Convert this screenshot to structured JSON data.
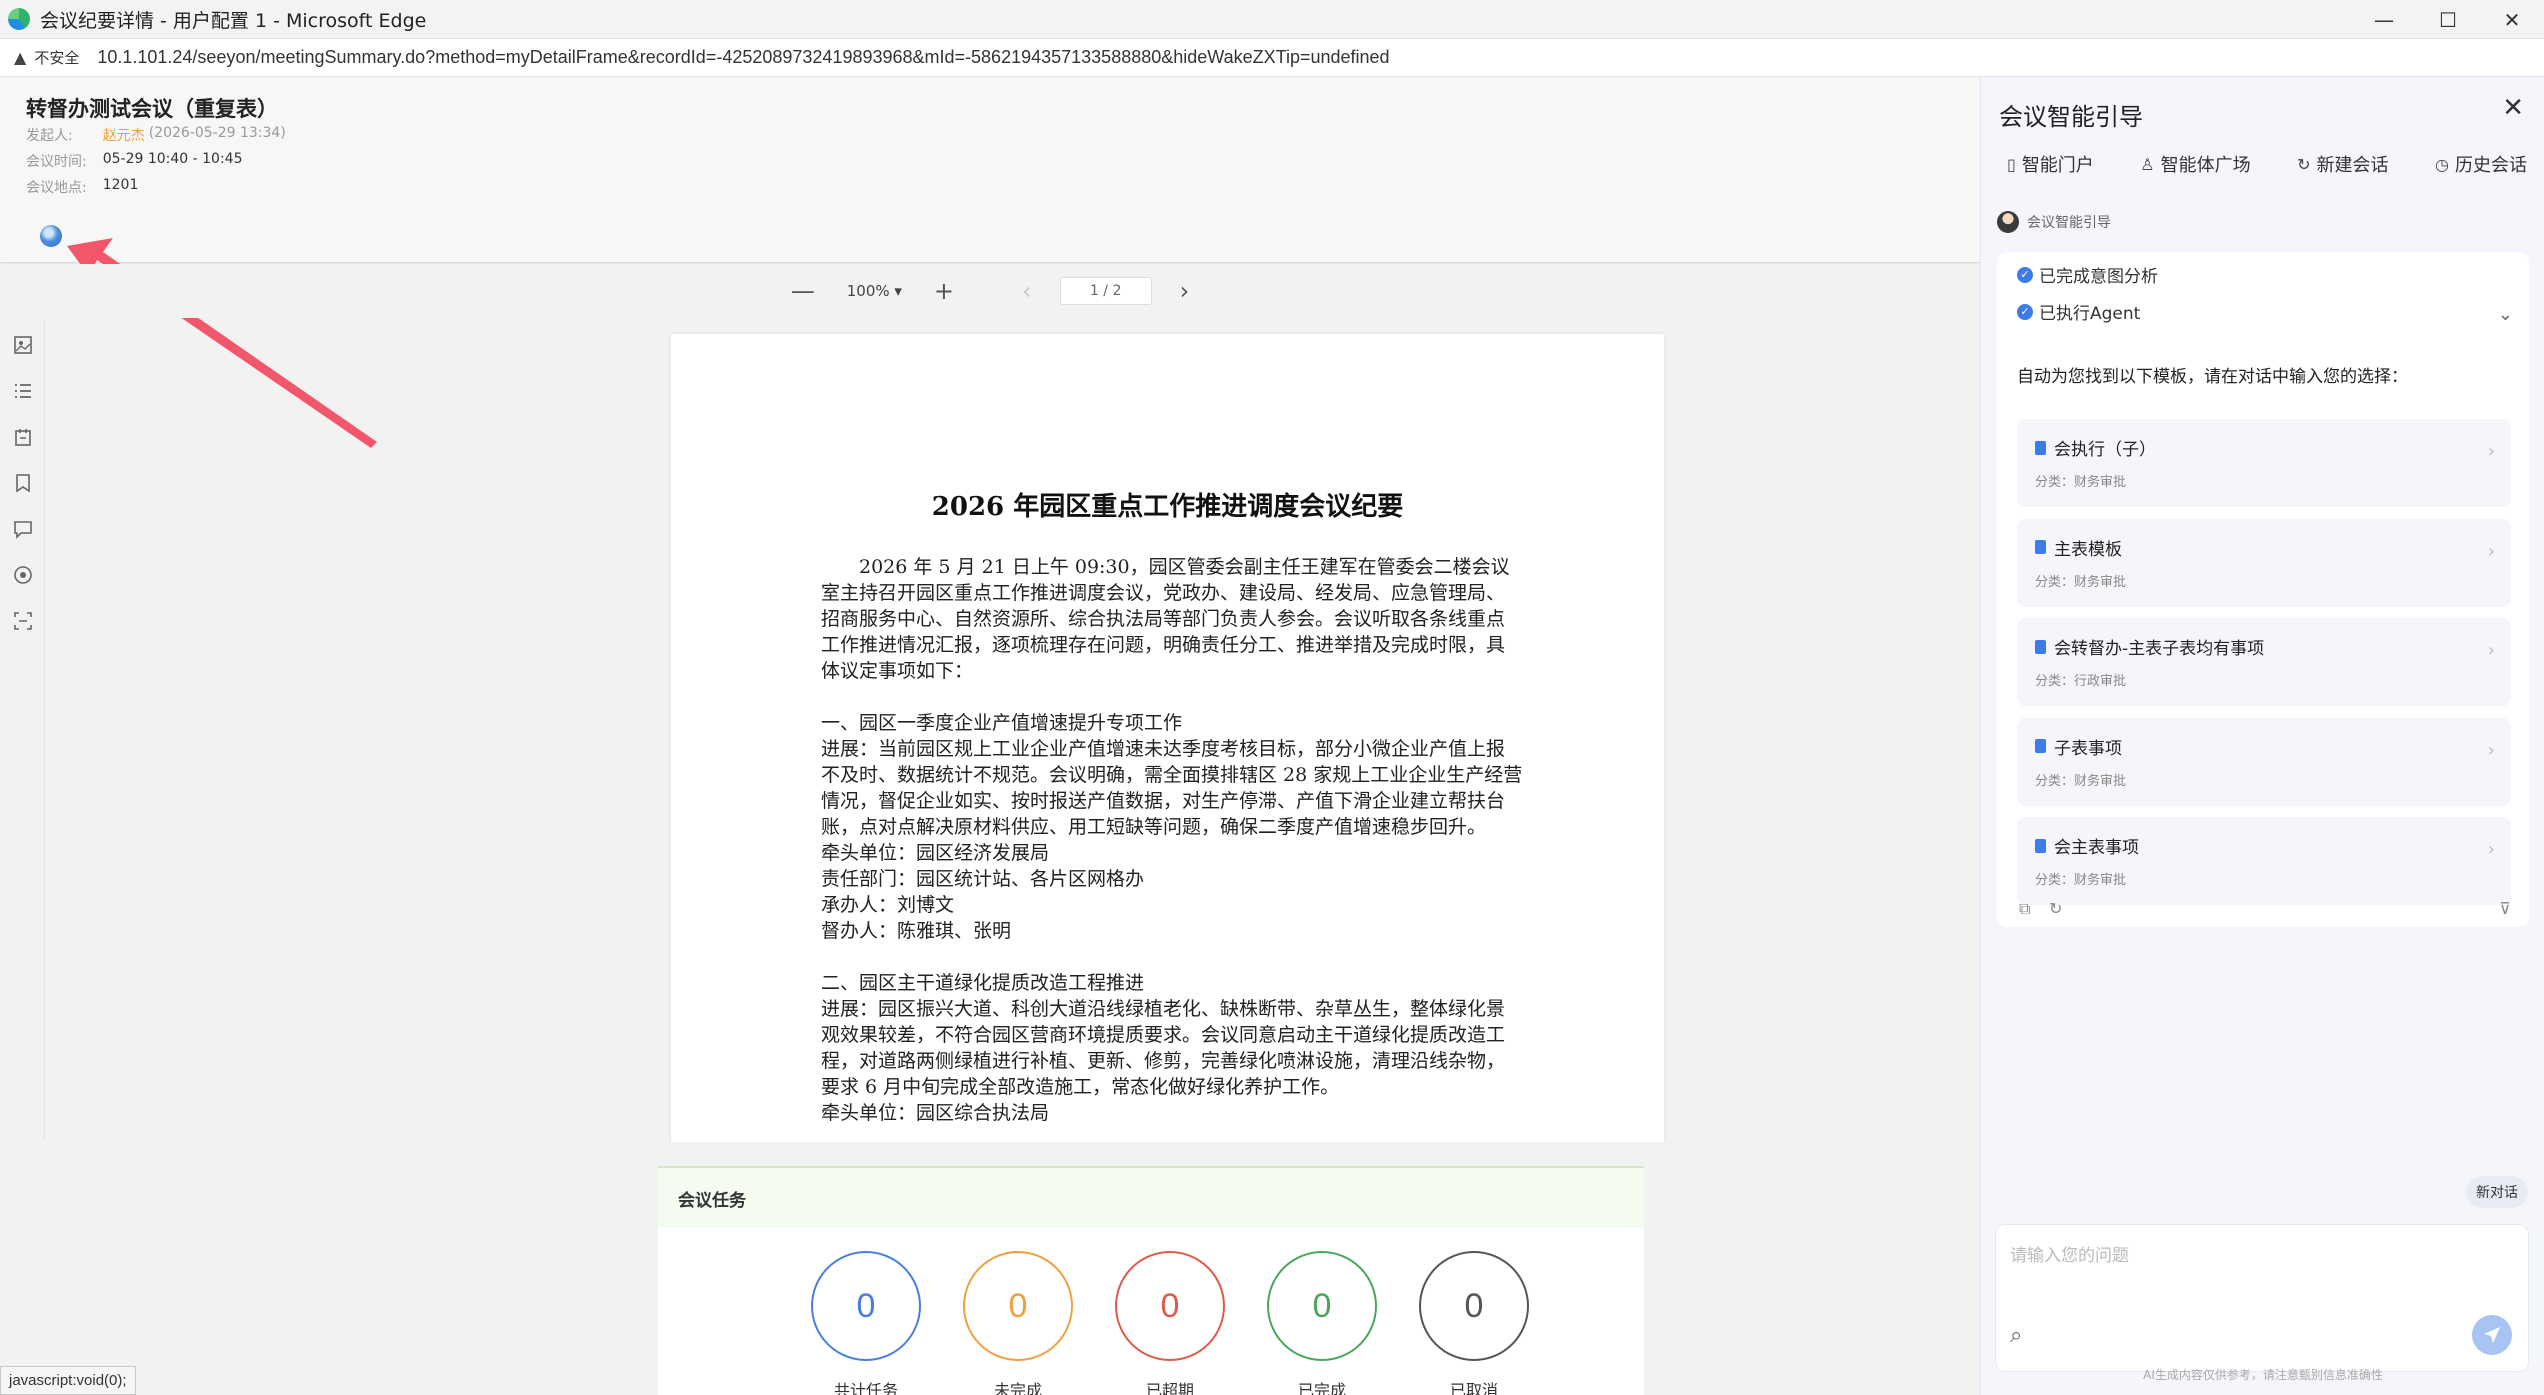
{
  "window": {
    "title": "会议纪要详情 - 用户配置 1 - Microsoft Edge",
    "minimize": "—",
    "maximize": "☐",
    "close": "✕"
  },
  "addressbar": {
    "security_label": "不安全",
    "url": "10.1.101.24/seeyon/meetingSummary.do?method=myDetailFrame&recordId=-4252089732419893968&mId=-5862194357133588880&hideWakeZXTip=undefined"
  },
  "meeting": {
    "title": "转督办测试会议（重复表）",
    "sponsor_label": "发起人:",
    "sponsor_name": "赵元杰",
    "sponsor_time": "(2026-05-29 13:34)",
    "time_label": "会议时间:",
    "time_value": "05-29 10:40 - 10:45",
    "place_label": "会议地点:",
    "place_value": "1201"
  },
  "viewer": {
    "zoom_out": "—",
    "zoom_level": "100% ▾",
    "zoom_in": "+",
    "prev": "‹",
    "page": "1 / 2",
    "next": "›"
  },
  "document": {
    "title": "2026 年园区重点工作推进调度会议纪要",
    "paragraphs": [
      "　　2026 年 5 月 21 日上午 09:30，园区管委会副主任王建军在管委会二楼会议室主持召开园区重点工作推进调度会议，党政办、建设局、经发局、应急管理局、招商服务中心、自然资源所、综合执法局等部门负责人参会。会议听取各条线重点工作推进情况汇报，逐项梳理存在问题，明确责任分工、推进举措及完成时限，具体议定事项如下：",
      "",
      "一、园区一季度企业产值增速提升专项工作",
      "进展：当前园区规上工业企业产值增速未达季度考核目标，部分小微企业产值上报不及时、数据统计不规范。会议明确，需全面摸排辖区 28 家规上工业企业生产经营情况，督促企业如实、按时报送产值数据，对生产停滞、产值下滑企业建立帮扶台账，点对点解决原材料供应、用工短缺等问题，确保二季度产值增速稳步回升。",
      "牵头单位：园区经济发展局",
      "责任部门：园区统计站、各片区网格办",
      "承办人：刘博文",
      "督办人：陈雅琪、张明",
      "",
      "二、园区主干道绿化提质改造工程推进",
      "进展：园区振兴大道、科创大道沿线绿植老化、缺株断带、杂草丛生，整体绿化景观效果较差，不符合园区营商环境提质要求。会议同意启动主干道绿化提质改造工程，对道路两侧绿植进行补植、更新、修剪，完善绿化喷淋设施，清理沿线杂物，要求 6 月中旬完成全部改造施工，常态化做好绿化养护工作。",
      "牵头单位：园区综合执法局"
    ]
  },
  "tasks": {
    "header": "会议任务",
    "items": [
      {
        "value": "0",
        "label": "共计任务",
        "color": "#4a7fe0"
      },
      {
        "value": "0",
        "label": "未完成",
        "color": "#f0a040"
      },
      {
        "value": "0",
        "label": "已超期",
        "color": "#e05a4a"
      },
      {
        "value": "0",
        "label": "已完成",
        "color": "#4aa65a"
      },
      {
        "value": "0",
        "label": "已取消",
        "color": "#555555"
      }
    ]
  },
  "statusbar": {
    "text": "javascript:void(0);"
  },
  "assistant": {
    "title": "会议智能引导",
    "close": "✕",
    "nav": [
      {
        "icon": "▯",
        "label": "智能门户"
      },
      {
        "icon": "♙",
        "label": "智能体广场"
      },
      {
        "icon": "↻",
        "label": "新建会话"
      },
      {
        "icon": "◷",
        "label": "历史会话"
      }
    ],
    "agent_name": "会议智能引导",
    "status": [
      {
        "label": "已完成意图分析"
      },
      {
        "label": "已执行Agent"
      }
    ],
    "prompt": "自动为您找到以下模板，请在对话中输入您的选择：",
    "templates": [
      {
        "name": "会执行（子）",
        "category": "分类：财务审批"
      },
      {
        "name": "主表模板",
        "category": "分类：财务审批"
      },
      {
        "name": "会转督办-主表子表均有事项",
        "category": "分类：行政审批"
      },
      {
        "name": "子表事项",
        "category": "分类：财务审批"
      },
      {
        "name": "会主表事项",
        "category": "分类：财务审批"
      }
    ],
    "new_chat": "新对话",
    "input_placeholder": "请输入您的问题",
    "disclaimer": "AI生成内容仅供参考，请注意甄别信息准确性"
  },
  "colors": {
    "accent": "#3c7bea",
    "arrow": "#f2566a",
    "sponsor": "#f0a030"
  }
}
